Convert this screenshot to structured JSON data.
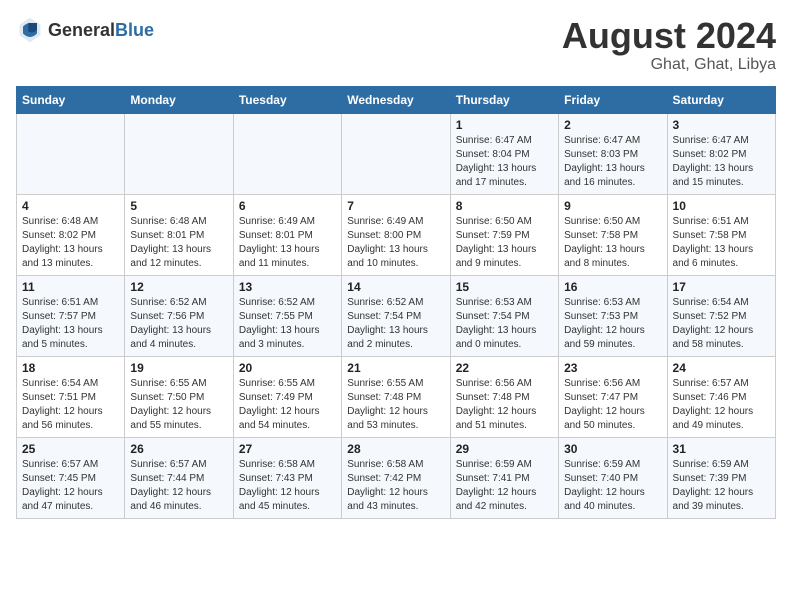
{
  "header": {
    "logo": {
      "general": "General",
      "blue": "Blue"
    },
    "title": "August 2024",
    "subtitle": "Ghat, Ghat, Libya"
  },
  "weekdays": [
    "Sunday",
    "Monday",
    "Tuesday",
    "Wednesday",
    "Thursday",
    "Friday",
    "Saturday"
  ],
  "weeks": [
    [
      {
        "day": "",
        "info": ""
      },
      {
        "day": "",
        "info": ""
      },
      {
        "day": "",
        "info": ""
      },
      {
        "day": "",
        "info": ""
      },
      {
        "day": "1",
        "info": "Sunrise: 6:47 AM\nSunset: 8:04 PM\nDaylight: 13 hours and 17 minutes."
      },
      {
        "day": "2",
        "info": "Sunrise: 6:47 AM\nSunset: 8:03 PM\nDaylight: 13 hours and 16 minutes."
      },
      {
        "day": "3",
        "info": "Sunrise: 6:47 AM\nSunset: 8:02 PM\nDaylight: 13 hours and 15 minutes."
      }
    ],
    [
      {
        "day": "4",
        "info": "Sunrise: 6:48 AM\nSunset: 8:02 PM\nDaylight: 13 hours and 13 minutes."
      },
      {
        "day": "5",
        "info": "Sunrise: 6:48 AM\nSunset: 8:01 PM\nDaylight: 13 hours and 12 minutes."
      },
      {
        "day": "6",
        "info": "Sunrise: 6:49 AM\nSunset: 8:01 PM\nDaylight: 13 hours and 11 minutes."
      },
      {
        "day": "7",
        "info": "Sunrise: 6:49 AM\nSunset: 8:00 PM\nDaylight: 13 hours and 10 minutes."
      },
      {
        "day": "8",
        "info": "Sunrise: 6:50 AM\nSunset: 7:59 PM\nDaylight: 13 hours and 9 minutes."
      },
      {
        "day": "9",
        "info": "Sunrise: 6:50 AM\nSunset: 7:58 PM\nDaylight: 13 hours and 8 minutes."
      },
      {
        "day": "10",
        "info": "Sunrise: 6:51 AM\nSunset: 7:58 PM\nDaylight: 13 hours and 6 minutes."
      }
    ],
    [
      {
        "day": "11",
        "info": "Sunrise: 6:51 AM\nSunset: 7:57 PM\nDaylight: 13 hours and 5 minutes."
      },
      {
        "day": "12",
        "info": "Sunrise: 6:52 AM\nSunset: 7:56 PM\nDaylight: 13 hours and 4 minutes."
      },
      {
        "day": "13",
        "info": "Sunrise: 6:52 AM\nSunset: 7:55 PM\nDaylight: 13 hours and 3 minutes."
      },
      {
        "day": "14",
        "info": "Sunrise: 6:52 AM\nSunset: 7:54 PM\nDaylight: 13 hours and 2 minutes."
      },
      {
        "day": "15",
        "info": "Sunrise: 6:53 AM\nSunset: 7:54 PM\nDaylight: 13 hours and 0 minutes."
      },
      {
        "day": "16",
        "info": "Sunrise: 6:53 AM\nSunset: 7:53 PM\nDaylight: 12 hours and 59 minutes."
      },
      {
        "day": "17",
        "info": "Sunrise: 6:54 AM\nSunset: 7:52 PM\nDaylight: 12 hours and 58 minutes."
      }
    ],
    [
      {
        "day": "18",
        "info": "Sunrise: 6:54 AM\nSunset: 7:51 PM\nDaylight: 12 hours and 56 minutes."
      },
      {
        "day": "19",
        "info": "Sunrise: 6:55 AM\nSunset: 7:50 PM\nDaylight: 12 hours and 55 minutes."
      },
      {
        "day": "20",
        "info": "Sunrise: 6:55 AM\nSunset: 7:49 PM\nDaylight: 12 hours and 54 minutes."
      },
      {
        "day": "21",
        "info": "Sunrise: 6:55 AM\nSunset: 7:48 PM\nDaylight: 12 hours and 53 minutes."
      },
      {
        "day": "22",
        "info": "Sunrise: 6:56 AM\nSunset: 7:48 PM\nDaylight: 12 hours and 51 minutes."
      },
      {
        "day": "23",
        "info": "Sunrise: 6:56 AM\nSunset: 7:47 PM\nDaylight: 12 hours and 50 minutes."
      },
      {
        "day": "24",
        "info": "Sunrise: 6:57 AM\nSunset: 7:46 PM\nDaylight: 12 hours and 49 minutes."
      }
    ],
    [
      {
        "day": "25",
        "info": "Sunrise: 6:57 AM\nSunset: 7:45 PM\nDaylight: 12 hours and 47 minutes."
      },
      {
        "day": "26",
        "info": "Sunrise: 6:57 AM\nSunset: 7:44 PM\nDaylight: 12 hours and 46 minutes."
      },
      {
        "day": "27",
        "info": "Sunrise: 6:58 AM\nSunset: 7:43 PM\nDaylight: 12 hours and 45 minutes."
      },
      {
        "day": "28",
        "info": "Sunrise: 6:58 AM\nSunset: 7:42 PM\nDaylight: 12 hours and 43 minutes."
      },
      {
        "day": "29",
        "info": "Sunrise: 6:59 AM\nSunset: 7:41 PM\nDaylight: 12 hours and 42 minutes."
      },
      {
        "day": "30",
        "info": "Sunrise: 6:59 AM\nSunset: 7:40 PM\nDaylight: 12 hours and 40 minutes."
      },
      {
        "day": "31",
        "info": "Sunrise: 6:59 AM\nSunset: 7:39 PM\nDaylight: 12 hours and 39 minutes."
      }
    ]
  ]
}
